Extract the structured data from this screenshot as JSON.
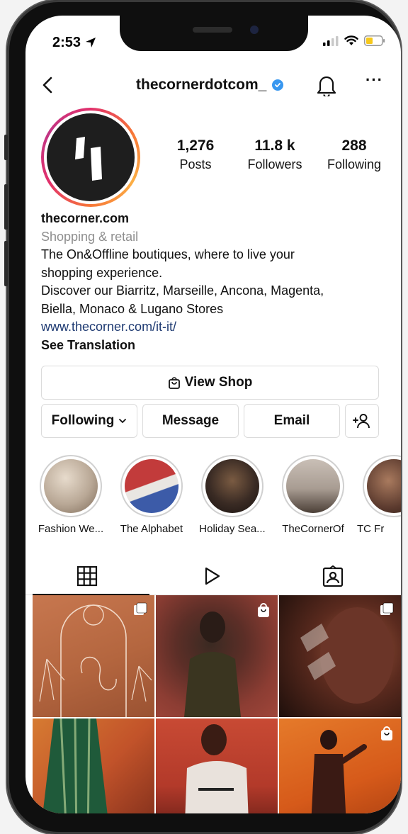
{
  "status_bar": {
    "time": "2:53"
  },
  "header": {
    "username": "thecornerdotcom_"
  },
  "stats": [
    {
      "value": "1,276",
      "label": "Posts"
    },
    {
      "value": "11.8 k",
      "label": "Followers"
    },
    {
      "value": "288",
      "label": "Following"
    }
  ],
  "bio": {
    "name": "thecorner.com",
    "category": "Shopping & retail",
    "line1": "The On&Offline boutiques, where to live your",
    "line2": "shopping experience.",
    "line3": "Discover our Biarritz, Marseille, Ancona, Magenta,",
    "line4": "Biella, Monaco & Lugano Stores",
    "link": "www.thecorner.com/it-it/",
    "translate": "See Translation"
  },
  "buttons": {
    "view_shop": "View Shop",
    "following": "Following",
    "message": "Message",
    "email": "Email"
  },
  "highlights": [
    {
      "label": "Fashion We...",
      "color": "#b9a896"
    },
    {
      "label": "The Alphabet",
      "color": "#c23b3b"
    },
    {
      "label": "Holiday Sea...",
      "color": "#3a2b24"
    },
    {
      "label": "TheCornerOf",
      "color": "#a89c92"
    },
    {
      "label": "TC Fr",
      "color": "#5b3a2e"
    }
  ],
  "tabs": {
    "grid_icon": "grid-icon",
    "reels_icon": "reels-icon",
    "tagged_icon": "tagged-icon"
  },
  "grid_posts": [
    {
      "color": "#b4663f",
      "badge": "multiple-icon"
    },
    {
      "color": "#8c3d33",
      "badge": "shop-bag-icon"
    },
    {
      "color": "#5a2a1e",
      "badge": "multiple-icon"
    },
    {
      "color": "#c2532a",
      "badge": ""
    },
    {
      "color": "#b33a2a",
      "badge": ""
    },
    {
      "color": "#d65a1a",
      "badge": "shop-bag-icon"
    }
  ],
  "colors": {
    "accent_link": "#1e3a72",
    "verified": "#3897f0"
  }
}
